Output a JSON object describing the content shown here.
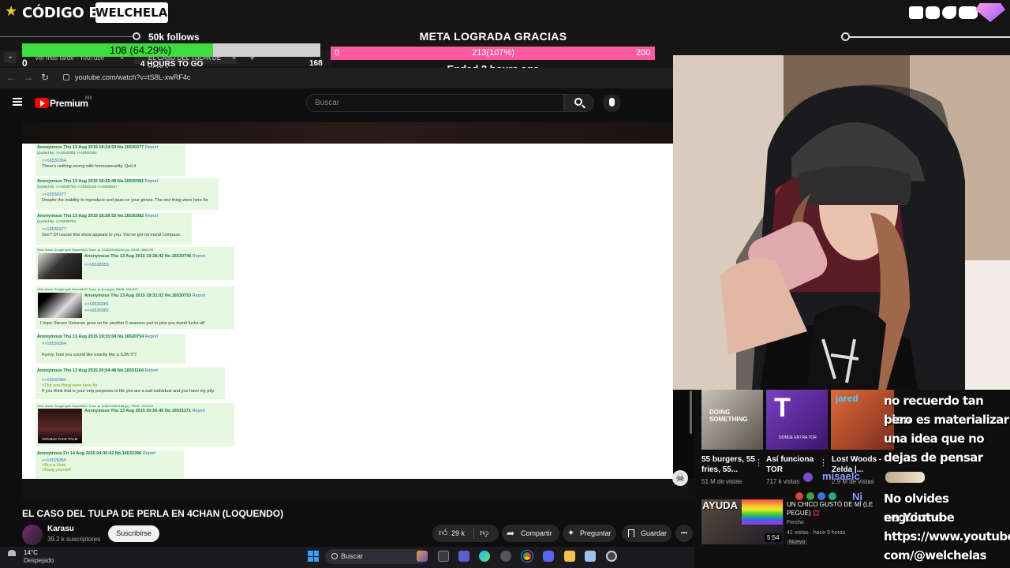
{
  "overlay": {
    "brand_title": "CÓDIGO EPIC",
    "brand_box": "WELCHELAS",
    "follows": {
      "label": "50k follows",
      "percent_text": "108 (64.29%)",
      "fill_fraction": 0.64,
      "min": "0",
      "max": "168",
      "time_left": "4 HOURS TO GO"
    },
    "meta": {
      "title": "META LOGRADA GRACIAS",
      "min": "0",
      "progress_text": "213(107%)",
      "max": "200",
      "ended": "Ended 2 hours ago"
    },
    "socials": [
      "twitch-icon",
      "instagram-icon",
      "twitter-icon",
      "youtube-icon"
    ]
  },
  "browser": {
    "tabs": [
      {
        "label": "Ver más tarde - YouTube",
        "close": "×"
      },
      {
        "label": "EL CASO DEL TULPA DE PERLA",
        "close": "×"
      }
    ],
    "new_tab": "+",
    "url": "youtube.com/watch?v=tS8L-xwRF4c"
  },
  "youtube": {
    "logo_text": "Premium",
    "region": "MX",
    "search_placeholder": "Buscar",
    "video_title": "EL CASO DEL TULPA DE PERLA EN 4CHAN (LOQUENDO)",
    "channel": "Karasu",
    "subscribers": "39.2 k suscriptores",
    "subscribe_label": "Suscribirse",
    "likes": "29 k",
    "share_label": "Compartir",
    "ask_label": "Preguntar",
    "save_label": "Guardar",
    "more": "•••"
  },
  "thread": [
    {
      "header": "Anonymous Thu 13 Aug 2015 18:24:53 No.16530377",
      "report": "Report",
      "quoted": "Quoted By: >>16530381 >>16530382",
      "lines": [
        ">>16530364",
        "There's nothing wrong with homosexuality. Quit it"
      ]
    },
    {
      "header": "Anonymous Thu 13 Aug 2015 18:26:49 No.16530381",
      "report": "Report",
      "quoted": "Quoted By: >>16530753 >>16531164 >>16535547",
      "lines": [
        ">>16530377",
        "Despite the inability to reproduce and pass on your genes. The one thing were here for"
      ]
    },
    {
      "header": "Anonymous Thu 13 Aug 2015 18:26:52 No.16530382",
      "report": "Report",
      "quoted": "Quoted By: >>16530753",
      "lines": [
        ">>16530377",
        "See? Of course this show appeals to you. You've got no moral compass."
      ]
    },
    {
      "meta": "View Same   Google   iqdb   SauceNAO   Trace   ▲ 1438355195262.jpg, 29KiB, 468x276",
      "header": "Anonymous Thu 13 Aug 2015 19:28:42 No.16530746",
      "report": "Report",
      "lines": [
        ">>16528355"
      ]
    },
    {
      "meta": "View Same   Google   iqdb   SauceNAO   Trace   ▲ smug.jpg, 28KiB, 544x327",
      "header": "Anonymous Thu 13 Aug 2015 19:31:02 No.16530753",
      "report": "Report",
      "lines": [
        ">>16530381",
        ">>16530382",
        "I hope Steven Universe goes on for another 5 seasons just to piss you dumb fucks off"
      ]
    },
    {
      "header": "Anonymous Thu 13 Aug 2015 19:31:04 No.16530754",
      "report": "Report",
      "lines": [
        ">>16530364",
        "Funny, how you sound like exactly like a SJW ITT"
      ]
    },
    {
      "header": "Anonymous Thu 13 Aug 2015 20:54:46 No.16531164",
      "report": "Report",
      "lines": [
        ">>16530381",
        ">The one thing were here for",
        "If you think that is your only purposes in life you are a sad individual and you have my pity."
      ]
    },
    {
      "meta": "View Same   Google   iqdb   SauceNAO   Trace   ▲ 1438493099188.jpg, 76KiB, 750x609",
      "header": "Anonymous Thu 13 Aug 2015 20:56:45 No.16531171",
      "report": "Report",
      "lines": []
    },
    {
      "header": "Anonymous Fri 14 Aug 2015 04:30:42 No.16533396",
      "report": "Report",
      "lines": [
        ">>16528355",
        ">Buy a Hate",
        ">Bang yourself"
      ]
    }
  ],
  "thumb_caption": "DOUBLE FACE PALM",
  "recommendations": [
    {
      "title": "55 burgers, 55 fries, 55...",
      "views": "51 M de vistas",
      "thumb_text": "DOING SOMETHING"
    },
    {
      "title": "Así funciona TOR",
      "views": "717 k vistas",
      "thumb_text": "DONDE ENTRA TOR"
    },
    {
      "title": "Lost Woods - Zelda |...",
      "views": "2.9 M de vistas",
      "thumb_text": "jared"
    }
  ],
  "rec_wide": {
    "overlay_text": "AYUDA",
    "title": "UN CHICO GUSTÓ DE MÍ (LE PEGUÉ) 💢",
    "channel": "Fercho",
    "views": "41 vistas · hace 9 horas",
    "badge": "Nuevo",
    "duration": "5:54"
  },
  "chat": {
    "lines": [
      "no recuerdo tan bien",
      "pero es materializar",
      "una idea que no",
      "dejas de pensar"
    ],
    "user": "misaelc",
    "user2": "Ni",
    "lines2": [
      "No olvides seguirme",
      "en Youtube",
      "https://www.youtube.",
      "com/@welchelas"
    ]
  },
  "taskbar": {
    "temp": "14°C",
    "weather": "Despejado",
    "search": "Buscar"
  }
}
